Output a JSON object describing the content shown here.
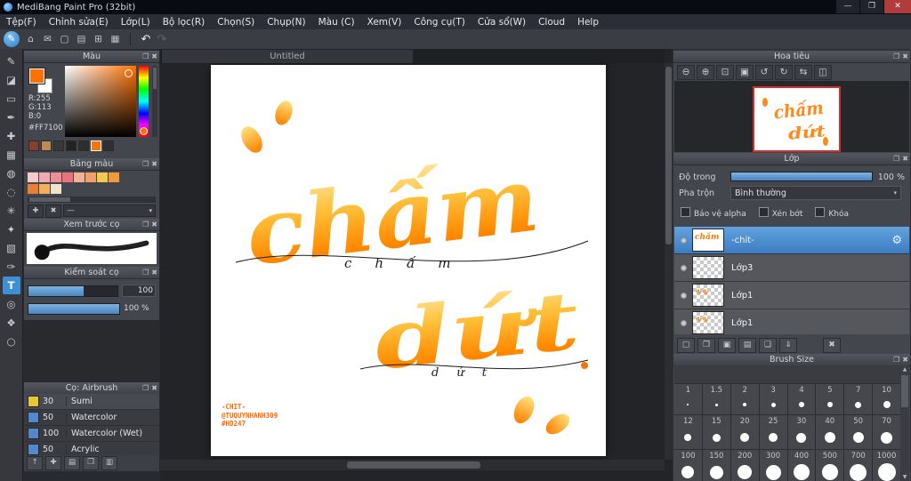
{
  "window": {
    "title": "MediBang Paint Pro (32bit)",
    "controls": {
      "min": "—",
      "max": "❐",
      "close": "✕"
    }
  },
  "ui": {
    "popout_glyph": "❐",
    "close_glyph": "✖"
  },
  "menu": {
    "items": [
      "Tệp(F)",
      "Chỉnh sửa(E)",
      "Lớp(L)",
      "Bộ lọc(R)",
      "Chọn(S)",
      "Chụp(N)",
      "Màu (C)",
      "Xem(V)",
      "Công cụ(T)",
      "Cửa sổ(W)",
      "Cloud",
      "Help"
    ]
  },
  "toolbar": {
    "active_tool_glyph": "✎",
    "icons": [
      {
        "name": "home-icon",
        "glyph": "⌂"
      },
      {
        "name": "message-icon",
        "glyph": "✉"
      },
      {
        "name": "clipboard-icon",
        "glyph": "▢"
      },
      {
        "name": "document-icon",
        "glyph": "▤"
      },
      {
        "name": "grid-icon",
        "glyph": "⊞"
      },
      {
        "name": "table-icon",
        "glyph": "▦"
      }
    ],
    "undo": "↶",
    "redo": "↷"
  },
  "tools": [
    {
      "name": "brush-tool",
      "glyph": "✎"
    },
    {
      "name": "eraser-tool",
      "glyph": "◪"
    },
    {
      "name": "rectangle-tool",
      "glyph": "▭"
    },
    {
      "name": "pen-tool",
      "glyph": "✒"
    },
    {
      "name": "move-tool",
      "glyph": "✚"
    },
    {
      "name": "select-tool",
      "glyph": "▦"
    },
    {
      "name": "bucket-tool",
      "glyph": "◍"
    },
    {
      "name": "lasso-tool",
      "glyph": "◌"
    },
    {
      "name": "wand-tool",
      "glyph": "✳"
    },
    {
      "name": "operation-tool",
      "glyph": "✦"
    },
    {
      "name": "gradient-tool",
      "glyph": "▧"
    },
    {
      "name": "path-tool",
      "glyph": "✑"
    },
    {
      "name": "text-tool",
      "glyph": "T",
      "active": true
    },
    {
      "name": "eyedropper-tool",
      "glyph": "◎"
    },
    {
      "name": "hand-tool",
      "glyph": "❖"
    },
    {
      "name": "zoom-tool",
      "glyph": "○"
    }
  ],
  "canvas": {
    "tab": "Untitled",
    "word1": "chấm",
    "word2": "dứt",
    "script1": "chấm",
    "script2": "dứt",
    "credits": [
      "-CHIT-",
      "@TUQUYNHANH309",
      "#HD247"
    ]
  },
  "colors": {
    "accent": "#3f8fd6",
    "selection": "#4b8bc8",
    "orange": "#FF7100"
  },
  "panels": {
    "color": {
      "title": "Màu",
      "r_label": "R:255",
      "g_label": "G:113",
      "b_label": "B:0",
      "hex": "#FF7100",
      "history": [
        "#8a3f2a",
        "#c08a55",
        "#383838",
        "#222222",
        "#2e2e2e",
        "#FF7100",
        "#303030"
      ],
      "selected_history_index": 5
    },
    "palette": {
      "title": "Bảng màu",
      "row1": [
        "#f6c9cd",
        "#f2aab2",
        "#ee8f98",
        "#ea737e",
        "#f4b193",
        "#f0a16b",
        "#f7c84e",
        "#f09a3e"
      ],
      "row2": [
        "#ee7f2f",
        "#f3b15f",
        "#efe3ce"
      ],
      "dropdown_value": "—"
    },
    "brush_preview": {
      "title": "Xem trước cọ"
    },
    "brush_control": {
      "title": "Kiểm soát cọ",
      "size_value": "100",
      "opacity_value": "100 %"
    },
    "brush_list": {
      "title": "Cọ: Airbrush",
      "items": [
        {
          "size": "30",
          "name": "Sumi",
          "color": "#e5c838"
        },
        {
          "size": "50",
          "name": "Watercolor",
          "color": "#5288cc"
        },
        {
          "size": "100",
          "name": "Watercolor (Wet)",
          "color": "#5288cc"
        },
        {
          "size": "50",
          "name": "Acrylic",
          "color": "#5288cc"
        }
      ],
      "bottom_icons": [
        {
          "name": "scroll-up-icon",
          "glyph": "↑"
        },
        {
          "name": "add-brush-icon",
          "glyph": "✚"
        },
        {
          "name": "brush-folder-icon",
          "glyph": "▤"
        },
        {
          "name": "duplicate-brush-icon",
          "glyph": "❐"
        },
        {
          "name": "brush-menu-icon",
          "glyph": "▥"
        }
      ]
    },
    "navigator": {
      "title": "Hoa tiêu",
      "icons": [
        {
          "name": "zoom-out-icon",
          "glyph": "⊖"
        },
        {
          "name": "zoom-in-icon",
          "glyph": "⊕"
        },
        {
          "name": "zoom-fit-icon",
          "glyph": "⊡"
        },
        {
          "name": "zoom-actual-icon",
          "glyph": "▣"
        },
        {
          "name": "rotate-left-icon",
          "glyph": "↺"
        },
        {
          "name": "rotate-right-icon",
          "glyph": "↻"
        },
        {
          "name": "reset-view-icon",
          "glyph": "⇆"
        },
        {
          "name": "flip-view-icon",
          "glyph": "◫"
        }
      ]
    },
    "layers": {
      "title": "Lớp",
      "opacity_label": "Độ trong",
      "opacity_value": "100 %",
      "blend_label": "Pha trộn",
      "blend_value": "Bình thường",
      "checkboxes": [
        "Bảo vệ alpha",
        "Xén bớt",
        "Khóa"
      ],
      "settings_glyph": "⚙",
      "thumb_squiggle": "∿∿",
      "items": [
        {
          "name": "-chit-",
          "selected": true,
          "thumb": "art"
        },
        {
          "name": "Lớp3",
          "thumb": "checker"
        },
        {
          "name": "Lớp1",
          "thumb": "checker-art"
        },
        {
          "name": "Lớp1",
          "thumb": "checker-art"
        }
      ],
      "bottom_icons": [
        {
          "name": "new-layer-icon",
          "glyph": "▢"
        },
        {
          "name": "duplicate-layer-icon",
          "glyph": "❐"
        },
        {
          "name": "new-folder-icon",
          "glyph": "▣"
        },
        {
          "name": "folder-icon",
          "glyph": "▤"
        },
        {
          "name": "copy-layer-icon",
          "glyph": "❏"
        },
        {
          "name": "merge-layer-icon",
          "glyph": "⇓"
        },
        {
          "name": "delete-layer-icon",
          "glyph": "✖"
        }
      ]
    },
    "brush_size": {
      "title": "Brush Size",
      "sizes": [
        "1",
        "1.5",
        "2",
        "3",
        "4",
        "5",
        "7",
        "10",
        "12",
        "15",
        "20",
        "25",
        "30",
        "40",
        "50",
        "70",
        "100",
        "150",
        "200",
        "300",
        "400",
        "500",
        "700",
        "1000"
      ]
    }
  }
}
